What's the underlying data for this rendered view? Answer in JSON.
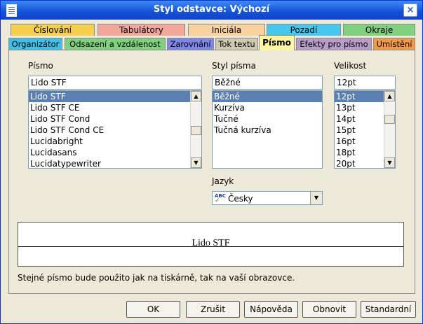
{
  "window": {
    "title": "Styl odstavce: Výchozí",
    "close_label": "×"
  },
  "tabs_row1": [
    {
      "label": "Číslování",
      "color": "#f6d04d"
    },
    {
      "label": "Tabulátory",
      "color": "#f3a79c"
    },
    {
      "label": "Iniciála",
      "color": "#f8d19c"
    },
    {
      "label": "Pozadí",
      "color": "#46c8ee"
    },
    {
      "label": "Okraje",
      "color": "#7fd17e"
    }
  ],
  "tabs_row2": [
    {
      "label": "Organizátor",
      "color": "#3fc0e8"
    },
    {
      "label": "Odsazení a vzdálenost",
      "color": "#7fd17e"
    },
    {
      "label": "Zarovnání",
      "color": "#7e86e8"
    },
    {
      "label": "Tok textu",
      "color": "#cfc9b2"
    },
    {
      "label": "Písmo",
      "color": "#fff7a0"
    },
    {
      "label": "Efekty pro písmo",
      "color": "#b79cc9"
    },
    {
      "label": "Umístění",
      "color": "#f39a47"
    }
  ],
  "font": {
    "label": "Písmo",
    "value": "Lido STF",
    "items": [
      "Lido STF",
      "Lido STF CE",
      "Lido STF Cond",
      "Lido STF Cond CE",
      "Lucidabright",
      "Lucidasans",
      "Lucidatypewriter"
    ],
    "selected_index": 0
  },
  "style": {
    "label": "Styl písma",
    "value": "Běžné",
    "items": [
      "Běžné",
      "Kurzíva",
      "Tučné",
      "Tučná kurzíva"
    ],
    "selected_index": 0
  },
  "size": {
    "label": "Velikost",
    "value": "12pt",
    "items": [
      "12pt",
      "13pt",
      "14pt",
      "15pt",
      "16pt",
      "18pt",
      "20pt"
    ],
    "selected_index": 0
  },
  "language": {
    "label": "Jazyk",
    "value": "Česky",
    "icon": "abc-spellcheck-icon"
  },
  "preview": {
    "text": "Lido STF"
  },
  "note": "Stejné písmo bude použito jak na tiskárně, tak na vaší obrazovce.",
  "buttons": {
    "ok": "OK",
    "cancel": "Zrušit",
    "help": "Nápověda",
    "reset": "Obnovit",
    "standard": "Standardní"
  }
}
